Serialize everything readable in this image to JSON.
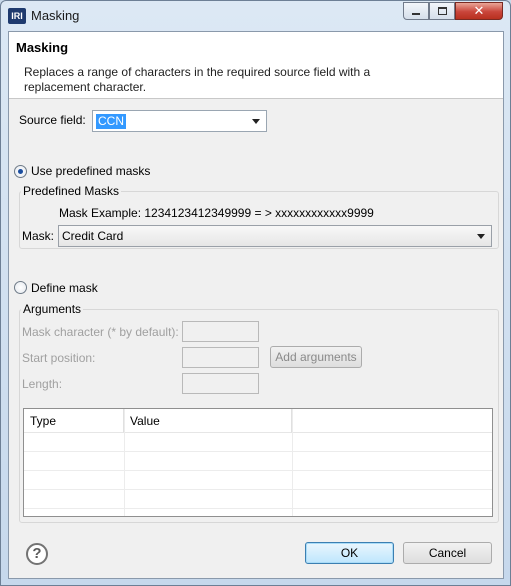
{
  "window": {
    "title": "Masking",
    "app_icon": "IRI"
  },
  "header": {
    "title": "Masking",
    "description": "Replaces a range of characters in the required source field with a replacement character."
  },
  "source_field": {
    "label": "Source field:",
    "value": "CCN"
  },
  "predefined": {
    "radio_label": "Use predefined masks",
    "checked": true,
    "group_title": "Predefined Masks",
    "example": "Mask Example: 1234123412349999 = > xxxxxxxxxxxx9999",
    "mask_label": "Mask:",
    "mask_value": "Credit Card"
  },
  "define": {
    "radio_label": "Define mask",
    "checked": false,
    "group_title": "Arguments",
    "mask_char_label": "Mask character (* by default):",
    "start_label": "Start position:",
    "length_label": "Length:",
    "add_button": "Add arguments"
  },
  "table": {
    "columns": [
      "Type",
      "Value"
    ],
    "rows": 5
  },
  "footer": {
    "ok": "OK",
    "cancel": "Cancel",
    "help_glyph": "?"
  }
}
